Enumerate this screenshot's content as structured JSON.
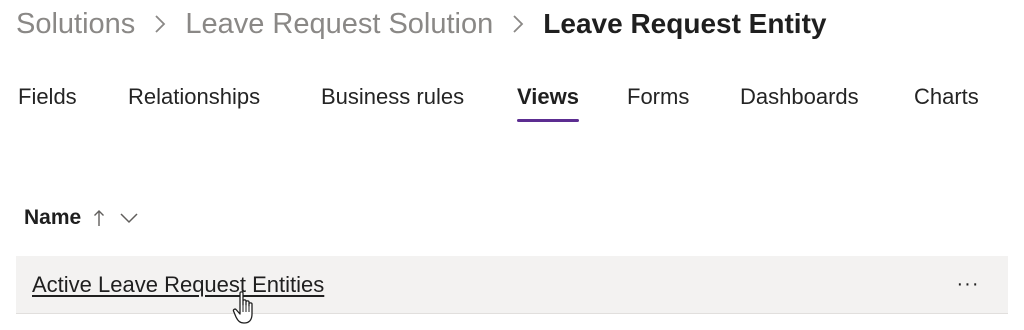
{
  "breadcrumb": {
    "items": [
      "Solutions",
      "Leave Request Solution"
    ],
    "current": "Leave Request Entity",
    "separator_icon": "chevron-right-icon"
  },
  "tabs": [
    {
      "label": "Fields",
      "active": false
    },
    {
      "label": "Relationships",
      "active": false
    },
    {
      "label": "Business rules",
      "active": false
    },
    {
      "label": "Views",
      "active": true
    },
    {
      "label": "Forms",
      "active": false
    },
    {
      "label": "Dashboards",
      "active": false
    },
    {
      "label": "Charts",
      "active": false
    }
  ],
  "table": {
    "column_header": "Name",
    "sort_icon": "sort-ascending-icon",
    "menu_icon": "chevron-down-icon",
    "rows": [
      {
        "name": "Active Leave Request Entities",
        "more_label": "···"
      }
    ]
  },
  "colors": {
    "accent": "#5c2d91",
    "row_background": "#f3f2f1",
    "breadcrumb_muted": "#8a8886"
  }
}
